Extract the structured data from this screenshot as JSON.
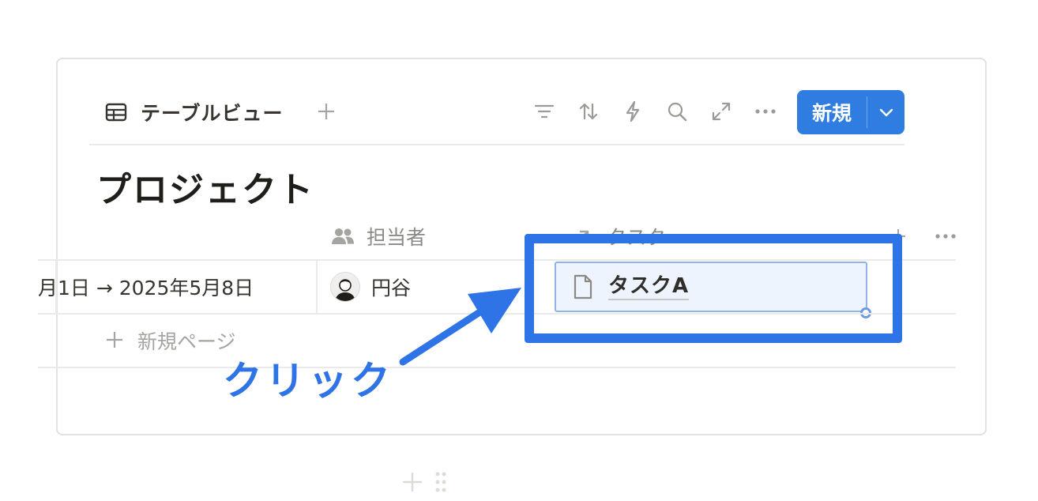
{
  "toolbar": {
    "view_label": "テーブルビュー",
    "view_icon": "table-icon",
    "tools": [
      "filter-icon",
      "sort-icon",
      "automation-icon",
      "search-icon",
      "expand-icon",
      "more-icon"
    ],
    "new_button_label": "新規",
    "accent": "#2f7de1"
  },
  "database": {
    "title": "プロジェクト"
  },
  "table": {
    "columns": [
      {
        "label": "担当者",
        "icon": "people-icon"
      },
      {
        "label": "タスク",
        "icon": "relation-icon"
      }
    ],
    "rows": [
      {
        "date_range": "月1日 → 2025年5月8日",
        "assignee": "円谷",
        "task": "タスクA"
      }
    ],
    "new_page_label": "新規ページ"
  },
  "annotation": {
    "label": "クリック",
    "color": "#2f74e6"
  }
}
